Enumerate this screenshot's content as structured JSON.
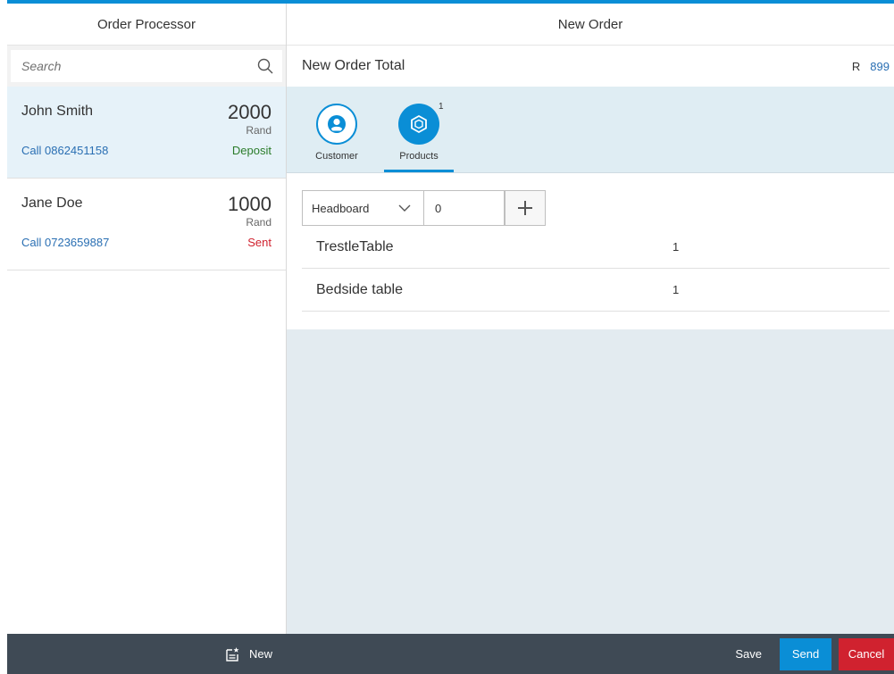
{
  "colors": {
    "accent": "#0a8ed6",
    "link": "#2a6fb3",
    "status_deposit": "#2b7c2b",
    "status_sent": "#d0222f",
    "footer": "#3f4a55",
    "cancel": "#d0222f"
  },
  "master": {
    "title": "Order Processor",
    "search": {
      "placeholder": "Search",
      "icon": "search-icon"
    },
    "orders": [
      {
        "name": "John Smith",
        "amount": "2000",
        "unit": "Rand",
        "phone": "Call 0862451158",
        "status": "Deposit",
        "selected": true
      },
      {
        "name": "Jane Doe",
        "amount": "1000",
        "unit": "Rand",
        "phone": "Call 0723659887",
        "status": "Sent",
        "selected": false
      }
    ],
    "footer": {
      "new_label": "New",
      "new_icon": "new-document-icon"
    }
  },
  "detail": {
    "title": "New Order",
    "header": {
      "title": "New Order Total",
      "currency": "R",
      "total": "899"
    },
    "tabs": [
      {
        "label": "Customer",
        "icon": "customer-icon",
        "selected": false
      },
      {
        "label": "Products",
        "icon": "products-icon",
        "selected": true,
        "count": "1"
      }
    ],
    "add_row": {
      "selected_product": "Headboard",
      "quantity": "0",
      "add_icon": "plus-icon"
    },
    "products": [
      {
        "name": "TrestleTable",
        "qty": "1"
      },
      {
        "name": "Bedside table",
        "qty": "1"
      }
    ],
    "footer": {
      "save_label": "Save",
      "send_label": "Send",
      "cancel_label": "Cancel"
    }
  }
}
